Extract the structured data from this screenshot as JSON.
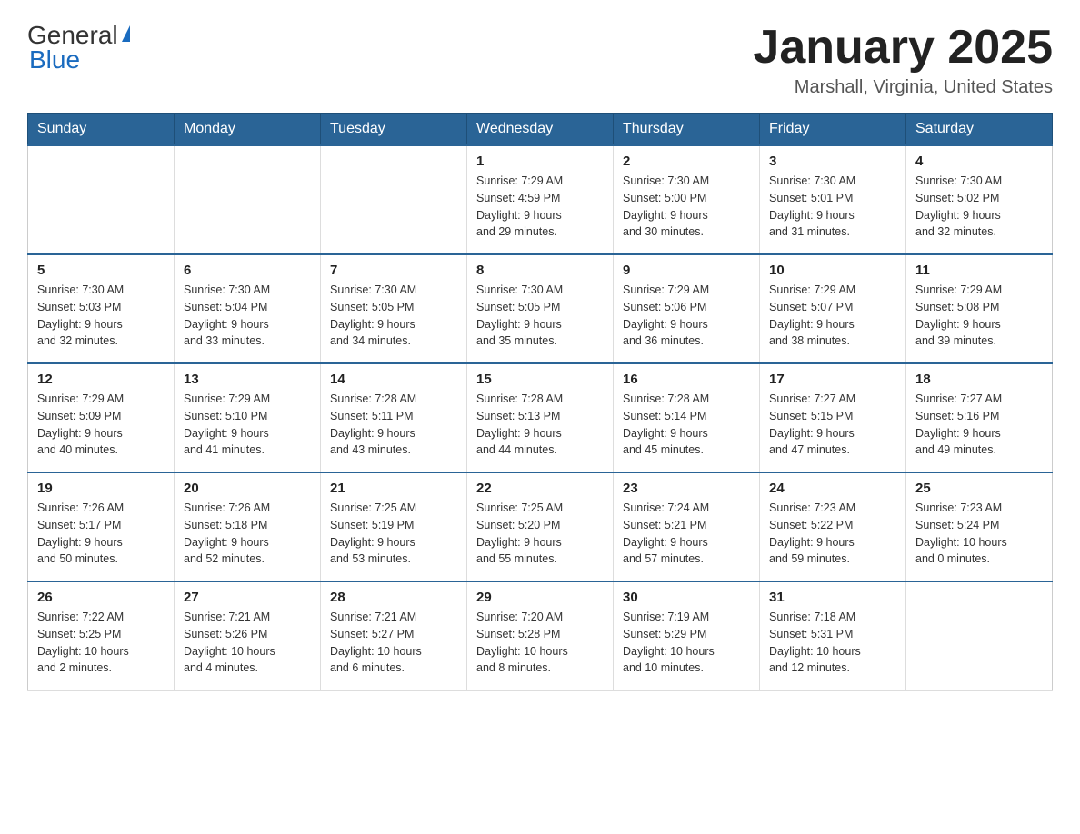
{
  "logo": {
    "text_general": "General",
    "text_blue": "Blue"
  },
  "header": {
    "title": "January 2025",
    "location": "Marshall, Virginia, United States"
  },
  "weekdays": [
    "Sunday",
    "Monday",
    "Tuesday",
    "Wednesday",
    "Thursday",
    "Friday",
    "Saturday"
  ],
  "weeks": [
    [
      null,
      null,
      null,
      {
        "day": 1,
        "sunrise": "7:29 AM",
        "sunset": "4:59 PM",
        "daylight": "9 hours and 29 minutes."
      },
      {
        "day": 2,
        "sunrise": "7:30 AM",
        "sunset": "5:00 PM",
        "daylight": "9 hours and 30 minutes."
      },
      {
        "day": 3,
        "sunrise": "7:30 AM",
        "sunset": "5:01 PM",
        "daylight": "9 hours and 31 minutes."
      },
      {
        "day": 4,
        "sunrise": "7:30 AM",
        "sunset": "5:02 PM",
        "daylight": "9 hours and 32 minutes."
      }
    ],
    [
      {
        "day": 5,
        "sunrise": "7:30 AM",
        "sunset": "5:03 PM",
        "daylight": "9 hours and 32 minutes."
      },
      {
        "day": 6,
        "sunrise": "7:30 AM",
        "sunset": "5:04 PM",
        "daylight": "9 hours and 33 minutes."
      },
      {
        "day": 7,
        "sunrise": "7:30 AM",
        "sunset": "5:05 PM",
        "daylight": "9 hours and 34 minutes."
      },
      {
        "day": 8,
        "sunrise": "7:30 AM",
        "sunset": "5:05 PM",
        "daylight": "9 hours and 35 minutes."
      },
      {
        "day": 9,
        "sunrise": "7:29 AM",
        "sunset": "5:06 PM",
        "daylight": "9 hours and 36 minutes."
      },
      {
        "day": 10,
        "sunrise": "7:29 AM",
        "sunset": "5:07 PM",
        "daylight": "9 hours and 38 minutes."
      },
      {
        "day": 11,
        "sunrise": "7:29 AM",
        "sunset": "5:08 PM",
        "daylight": "9 hours and 39 minutes."
      }
    ],
    [
      {
        "day": 12,
        "sunrise": "7:29 AM",
        "sunset": "5:09 PM",
        "daylight": "9 hours and 40 minutes."
      },
      {
        "day": 13,
        "sunrise": "7:29 AM",
        "sunset": "5:10 PM",
        "daylight": "9 hours and 41 minutes."
      },
      {
        "day": 14,
        "sunrise": "7:28 AM",
        "sunset": "5:11 PM",
        "daylight": "9 hours and 43 minutes."
      },
      {
        "day": 15,
        "sunrise": "7:28 AM",
        "sunset": "5:13 PM",
        "daylight": "9 hours and 44 minutes."
      },
      {
        "day": 16,
        "sunrise": "7:28 AM",
        "sunset": "5:14 PM",
        "daylight": "9 hours and 45 minutes."
      },
      {
        "day": 17,
        "sunrise": "7:27 AM",
        "sunset": "5:15 PM",
        "daylight": "9 hours and 47 minutes."
      },
      {
        "day": 18,
        "sunrise": "7:27 AM",
        "sunset": "5:16 PM",
        "daylight": "9 hours and 49 minutes."
      }
    ],
    [
      {
        "day": 19,
        "sunrise": "7:26 AM",
        "sunset": "5:17 PM",
        "daylight": "9 hours and 50 minutes."
      },
      {
        "day": 20,
        "sunrise": "7:26 AM",
        "sunset": "5:18 PM",
        "daylight": "9 hours and 52 minutes."
      },
      {
        "day": 21,
        "sunrise": "7:25 AM",
        "sunset": "5:19 PM",
        "daylight": "9 hours and 53 minutes."
      },
      {
        "day": 22,
        "sunrise": "7:25 AM",
        "sunset": "5:20 PM",
        "daylight": "9 hours and 55 minutes."
      },
      {
        "day": 23,
        "sunrise": "7:24 AM",
        "sunset": "5:21 PM",
        "daylight": "9 hours and 57 minutes."
      },
      {
        "day": 24,
        "sunrise": "7:23 AM",
        "sunset": "5:22 PM",
        "daylight": "9 hours and 59 minutes."
      },
      {
        "day": 25,
        "sunrise": "7:23 AM",
        "sunset": "5:24 PM",
        "daylight": "10 hours and 0 minutes."
      }
    ],
    [
      {
        "day": 26,
        "sunrise": "7:22 AM",
        "sunset": "5:25 PM",
        "daylight": "10 hours and 2 minutes."
      },
      {
        "day": 27,
        "sunrise": "7:21 AM",
        "sunset": "5:26 PM",
        "daylight": "10 hours and 4 minutes."
      },
      {
        "day": 28,
        "sunrise": "7:21 AM",
        "sunset": "5:27 PM",
        "daylight": "10 hours and 6 minutes."
      },
      {
        "day": 29,
        "sunrise": "7:20 AM",
        "sunset": "5:28 PM",
        "daylight": "10 hours and 8 minutes."
      },
      {
        "day": 30,
        "sunrise": "7:19 AM",
        "sunset": "5:29 PM",
        "daylight": "10 hours and 10 minutes."
      },
      {
        "day": 31,
        "sunrise": "7:18 AM",
        "sunset": "5:31 PM",
        "daylight": "10 hours and 12 minutes."
      },
      null
    ]
  ],
  "labels": {
    "sunrise": "Sunrise:",
    "sunset": "Sunset:",
    "daylight": "Daylight:"
  }
}
